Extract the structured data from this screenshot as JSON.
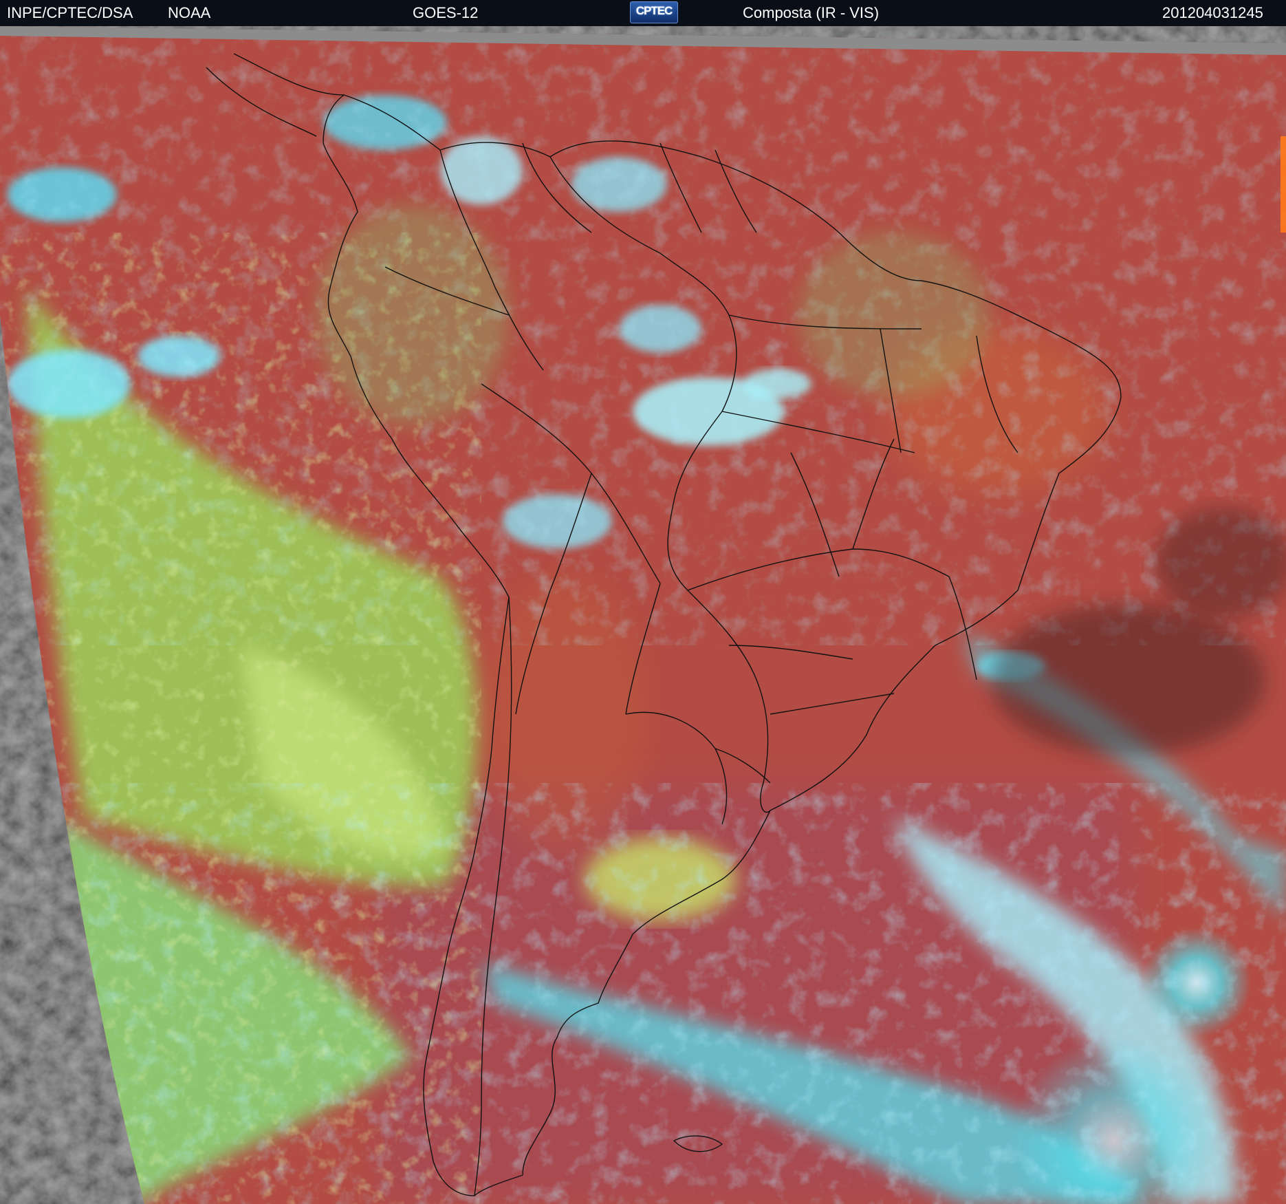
{
  "header": {
    "institution": "INPE/CPTEC/DSA",
    "agency": "NOAA",
    "satellite": "GOES-12",
    "logo_text": "CPTEC",
    "product": "Composta (IR - VIS)",
    "timestamp": "201204031245"
  },
  "map": {
    "region": "South America",
    "colors": {
      "background_space": "#000000",
      "outside_disk_gray": "#4a4a4a",
      "land_red": "#b04a42",
      "ocean_red": "#b54f45",
      "low_cloud_yellow_green": "#a8d85a",
      "high_cloud_cyan": "#40e6ff",
      "cold_cloud_light_cyan": "#a8f4ff",
      "boundary_lines": "#111111",
      "top_gray_strip": "#8a8a8a"
    }
  }
}
